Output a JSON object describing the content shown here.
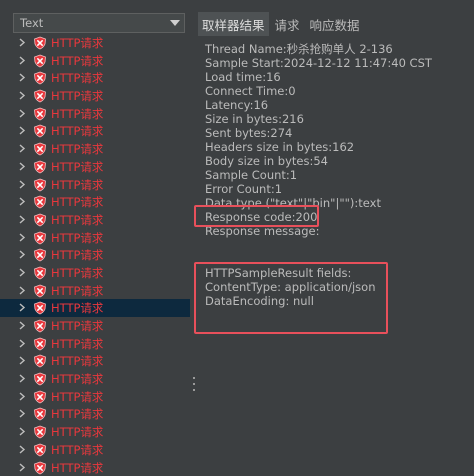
{
  "filter": {
    "value": "Text"
  },
  "tree": {
    "item_label": "HTTP请求",
    "item_count": 26,
    "selected_index": 15
  },
  "tabs": [
    {
      "label": "取样器结果"
    },
    {
      "label": "请求"
    },
    {
      "label": "响应数据"
    }
  ],
  "result": {
    "thread_name": "Thread Name:秒杀抢购单人 2-136",
    "sample_start": "Sample Start:2024-12-12 11:47:40 CST",
    "load_time": "Load time:16",
    "connect_time": "Connect Time:0",
    "latency": "Latency:16",
    "size_bytes": "Size in bytes:216",
    "sent_bytes": "Sent bytes:274",
    "headers_size": "Headers size in bytes:162",
    "body_size": "Body size in bytes:54",
    "sample_count": "Sample Count:1",
    "error_count": "Error Count:1",
    "data_type": "Data type (\"text\"|\"bin\"|\"\"):text",
    "response_code": "Response code:200",
    "response_message": "Response message:",
    "fields_header": "HTTPSampleResult fields:",
    "content_type": "ContentType: application/json",
    "data_encoding": "DataEncoding: null"
  },
  "colors": {
    "error_red": "#e8383d",
    "highlight_red": "#e8505b",
    "selected_row": "#0d293e"
  }
}
